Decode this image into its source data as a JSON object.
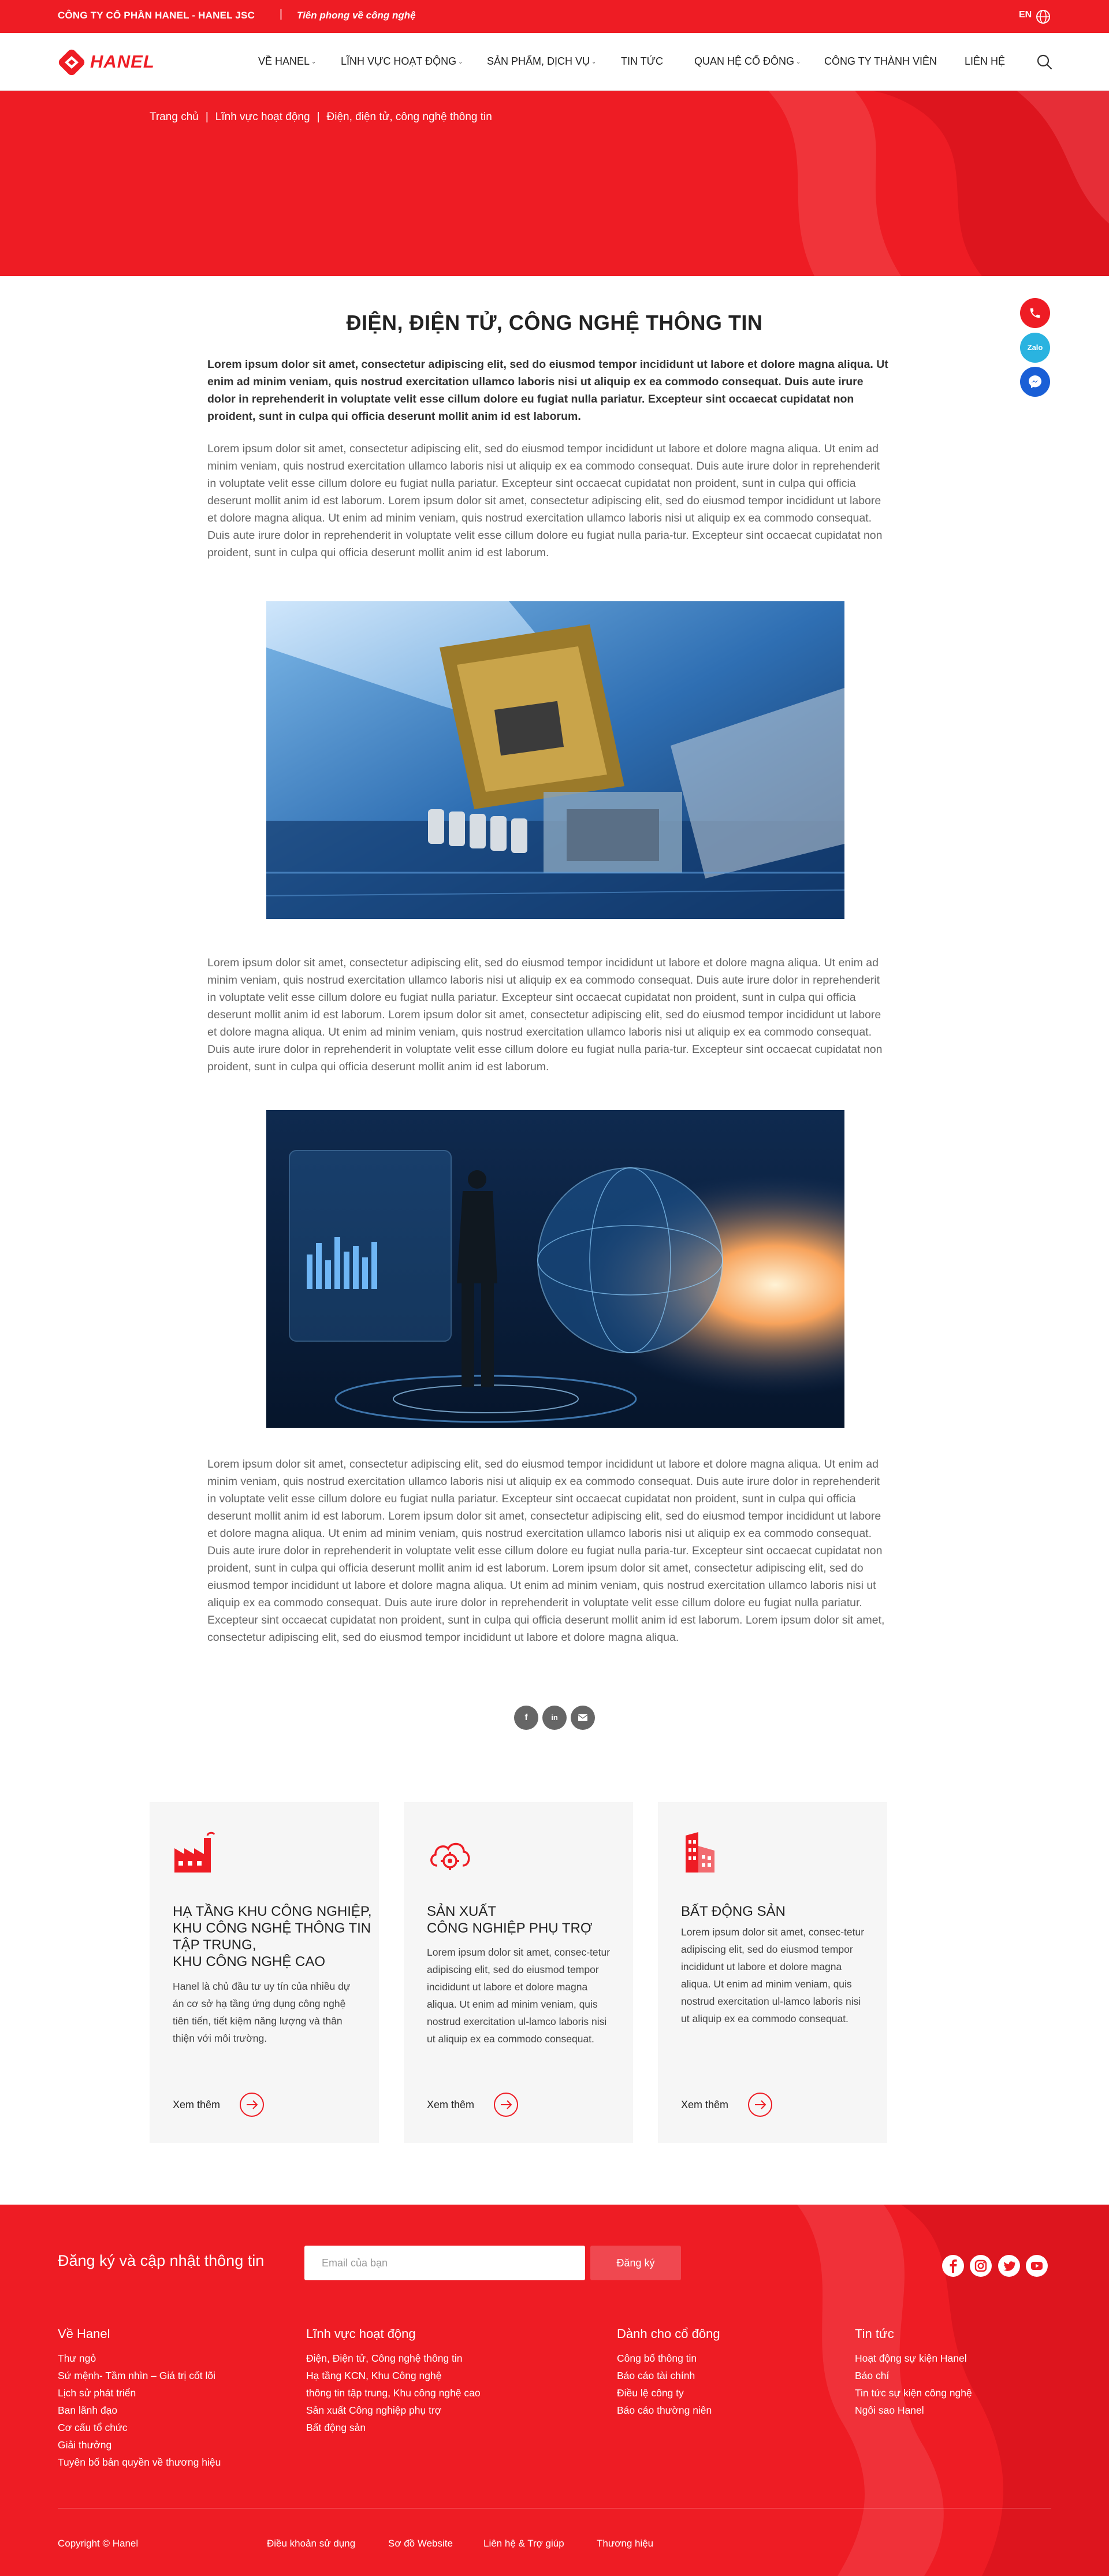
{
  "topbar": {
    "company": "CÔNG TY CỔ PHẦN HANEL - HANEL JSC",
    "separator": "|",
    "slogan": "Tiên phong về công nghệ",
    "lang": "EN"
  },
  "header": {
    "logo_text": "HANEL",
    "nav": [
      {
        "label": "VỀ HANEL",
        "has_dropdown": true
      },
      {
        "label": "LĨNH VỰC HOẠT ĐỘNG",
        "has_dropdown": true
      },
      {
        "label": "SẢN PHẨM, DỊCH VỤ",
        "has_dropdown": true
      },
      {
        "label": "TIN TỨC",
        "has_dropdown": false
      },
      {
        "label": "QUAN HỆ CỔ ĐÔNG",
        "has_dropdown": true
      },
      {
        "label": "CÔNG TY THÀNH VIÊN",
        "has_dropdown": false
      },
      {
        "label": "LIÊN HỆ",
        "has_dropdown": false
      }
    ],
    "search_icon": "search-icon"
  },
  "breadcrumb": {
    "items": [
      "Trang chủ",
      "Lĩnh vực hoạt động",
      "Điện, điện tử, công nghệ thông tin"
    ],
    "divider": "|"
  },
  "float_contact": {
    "zalo_label": "Zalo",
    "icons": [
      "phone-icon",
      "zalo-icon",
      "messenger-icon"
    ]
  },
  "article": {
    "title": "ĐIỆN, ĐIỆN TỬ, CÔNG NGHỆ THÔNG TIN",
    "lead": "Lorem ipsum dolor sit amet, consectetur adipiscing elit, sed do eiusmod tempor incididunt ut labore et dolore magna aliqua. Ut enim ad minim veniam, quis nostrud exercitation ullamco laboris nisi ut aliquip ex ea commodo consequat. Duis aute irure dolor in reprehenderit in voluptate velit esse cillum dolore eu fugiat nulla pariatur. Excepteur sint occaecat cupidatat non proident, sunt in culpa qui officia deserunt mollit anim id est laborum.",
    "para1": "Lorem ipsum dolor sit amet, consectetur adipiscing elit, sed do eiusmod tempor incididunt ut labore et dolore magna aliqua. Ut enim ad minim veniam, quis nostrud exercitation ullamco laboris nisi ut aliquip ex ea commodo consequat. Duis aute irure dolor in reprehenderit in voluptate velit esse cillum dolore eu fugiat nulla pariatur. Excepteur sint occaecat cupidatat non proident, sunt in culpa qui officia deserunt mollit anim id est laborum. Lorem ipsum dolor sit amet, consectetur adipiscing elit, sed do eiusmod tempor incididunt ut labore et dolore magna aliqua. Ut enim ad minim veniam, quis nostrud exercitation ullamco laboris nisi ut aliquip ex ea commodo consequat. Duis aute irure dolor in reprehenderit in voluptate velit esse cillum dolore eu fugiat nulla paria-tur. Excepteur sint occaecat cupidatat non proident, sunt in culpa qui officia deserunt mollit anim id est laborum.",
    "para2": "Lorem ipsum dolor sit amet, consectetur adipiscing elit, sed do eiusmod tempor incididunt ut labore et dolore magna aliqua. Ut enim ad minim veniam, quis nostrud exercitation ullamco laboris nisi ut aliquip ex ea commodo consequat. Duis aute irure dolor in reprehenderit in voluptate velit esse cillum dolore eu fugiat nulla pariatur. Excepteur sint occaecat cupidatat non proident, sunt in culpa qui officia deserunt mollit anim id est laborum. Lorem ipsum dolor sit amet, consectetur adipiscing elit, sed do eiusmod tempor incididunt ut labore et dolore magna aliqua. Ut enim ad minim veniam, quis nostrud exercitation ullamco laboris nisi ut aliquip ex ea commodo consequat. Duis aute irure dolor in reprehenderit in voluptate velit esse cillum dolore eu fugiat nulla paria-tur. Excepteur sint occaecat cupidatat non proident, sunt in culpa qui officia deserunt mollit anim id est laborum.",
    "para3": "Lorem ipsum dolor sit amet, consectetur adipiscing elit, sed do eiusmod tempor incididunt ut labore et dolore magna aliqua. Ut enim ad minim veniam, quis nostrud exercitation ullamco laboris nisi ut aliquip ex ea commodo consequat. Duis aute irure dolor in reprehenderit in voluptate velit esse cillum dolore eu fugiat nulla pariatur. Excepteur sint occaecat cupidatat non proident, sunt in culpa qui officia deserunt mollit anim id est laborum. Lorem ipsum dolor sit amet, consectetur adipiscing elit, sed do eiusmod tempor incididunt ut labore et dolore magna aliqua. Ut enim ad minim veniam, quis nostrud exercitation ullamco laboris nisi ut aliquip ex ea commodo consequat. Duis aute irure dolor in reprehenderit in voluptate velit esse cillum dolore eu fugiat nulla paria-tur. Excepteur sint occaecat cupidatat non proident, sunt in culpa qui officia deserunt mollit anim id est laborum. Lorem ipsum dolor sit amet, consectetur adipiscing elit, sed do eiusmod tempor incididunt ut labore et dolore magna aliqua. Ut enim ad minim veniam, quis nostrud exercitation ullamco laboris nisi ut aliquip ex ea commodo consequat. Duis aute irure dolor in reprehenderit in voluptate velit esse cillum dolore eu fugiat nulla pariatur. Excepteur sint occaecat cupidatat non proident, sunt in culpa qui officia deserunt mollit anim id est laborum. Lorem ipsum dolor sit amet, consectetur adipiscing elit, sed do eiusmod tempor incididunt ut labore et dolore magna aliqua.",
    "images": [
      "cpu-chip-photo",
      "digital-globe-interface-photo"
    ],
    "share_icons": [
      "facebook-icon",
      "linkedin-icon",
      "email-icon"
    ]
  },
  "cards": [
    {
      "icon": "factory-icon",
      "title_lines": [
        "HẠ TẦNG KHU CÔNG NGHIỆP,",
        "KHU CÔNG NGHỆ THÔNG TIN",
        "TẬP TRUNG,",
        "KHU CÔNG NGHỆ CAO"
      ],
      "desc": "Hanel là chủ đầu tư uy tín của nhiều dự án cơ sở hạ tầng ứng dụng công nghệ tiên tiến, tiết kiệm năng lượng và thân thiện với môi trường.",
      "more": "Xem thêm"
    },
    {
      "icon": "cloud-gear-icon",
      "title_lines": [
        "SẢN XUẤT",
        "CÔNG NGHIỆP PHỤ TRỢ"
      ],
      "desc": "Lorem ipsum dolor sit amet, consec-tetur adipiscing elit, sed do eiusmod tempor incididunt ut labore et dolore magna aliqua. Ut enim ad minim veniam, quis nostrud exercitation ul-lamco laboris nisi ut aliquip ex ea commodo consequat.",
      "more": "Xem thêm"
    },
    {
      "icon": "buildings-icon",
      "title_lines": [
        "BẤT ĐỘNG SẢN"
      ],
      "desc": "Lorem ipsum dolor sit amet, consec-tetur adipiscing elit, sed do eiusmod tempor incididunt ut labore et dolore magna aliqua. Ut enim ad minim veniam, quis nostrud exercitation ul-lamco laboris nisi ut aliquip ex ea commodo consequat.",
      "more": "Xem thêm"
    }
  ],
  "footer": {
    "subscribe_label": "Đăng ký và cập nhật thông tin",
    "email_placeholder": "Email của bạn",
    "subscribe_button": "Đăng ký",
    "social_icons": [
      "facebook-icon",
      "instagram-icon",
      "twitter-icon",
      "youtube-icon"
    ],
    "columns": [
      {
        "title": "Về Hanel",
        "links": [
          "Thư ngỏ",
          "Sứ mệnh- Tầm nhìn – Giá trị cốt lõi",
          "Lịch sử phát triển",
          "Ban lãnh đạo",
          "Cơ cấu tổ chức",
          "Giải thưởng",
          "Tuyên bố bản quyền về thương hiệu"
        ]
      },
      {
        "title": "Lĩnh vực hoạt động",
        "links": [
          "Điện, Điện tử, Công nghệ thông tin",
          "Hạ tầng KCN, Khu Công nghệ",
          "thông tin tập trung, Khu công nghệ cao",
          "Sản xuất Công nghiệp phụ trợ",
          "Bất động sản"
        ]
      },
      {
        "title": "Dành cho cổ đông",
        "links": [
          "Công bố thông tin",
          "Báo cáo tài chính",
          "Điều lệ công ty",
          "Báo cáo thường niên"
        ]
      },
      {
        "title": "Tin tức",
        "links": [
          "Hoạt động sự kiện Hanel",
          "Báo chí",
          "Tin tức sự kiện công nghệ",
          "Ngôi sao Hanel"
        ]
      }
    ],
    "copyright": "Copyright © Hanel",
    "bottom_links": [
      "Điều khoản sử dụng",
      "Sơ đồ Website",
      "Liên hệ & Trợ giúp",
      "Thương hiệu"
    ]
  },
  "colors": {
    "brand_red": "#ee1c24",
    "zalo_blue": "#2ab3e0",
    "messenger_blue": "#1a5fd6"
  }
}
